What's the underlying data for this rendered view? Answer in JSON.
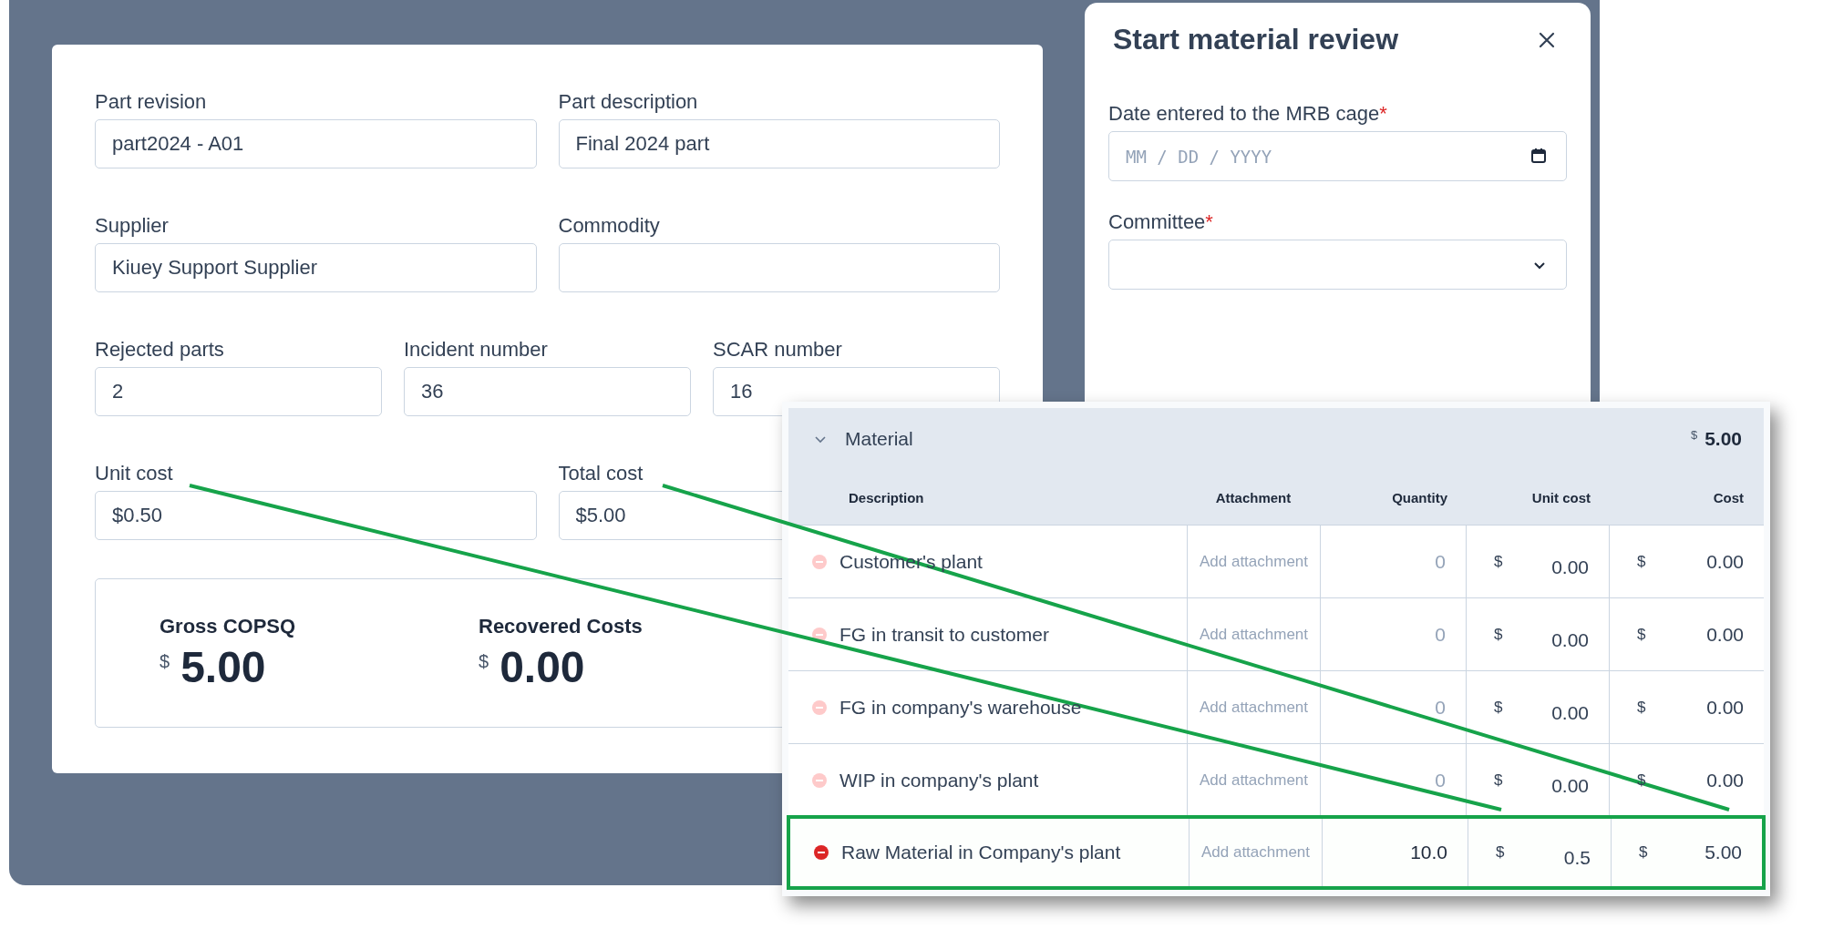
{
  "form": {
    "rows": [
      [
        {
          "label": "Part revision",
          "value": "part2024 - A01"
        },
        {
          "label": "Part description",
          "value": "Final 2024 part"
        }
      ],
      [
        {
          "label": "Supplier",
          "value": "Kiuey Support Supplier"
        },
        {
          "label": "Commodity"
        }
      ],
      [
        {
          "label": "Rejected parts",
          "value": "2"
        },
        {
          "label": "Incident number",
          "value": "36"
        },
        {
          "label": "SCAR number",
          "value": "16"
        }
      ],
      [
        {
          "label": "Unit cost",
          "value": "$0.50"
        },
        {
          "label": "Total cost",
          "value": "$5.00"
        }
      ]
    ],
    "summary": [
      {
        "label": "Gross COPSQ",
        "currency": "$",
        "amount": "5.00"
      },
      {
        "label": "Recovered Costs",
        "currency": "$",
        "amount": "0.00"
      }
    ]
  },
  "panel": {
    "title": "Start material review",
    "fields": [
      {
        "kind": "date",
        "label": "Date entered to the MRB cage",
        "required_mark": "*",
        "placeholder": "MM / DD / YYYY"
      },
      {
        "kind": "select",
        "label": "Committee",
        "required_mark": "*"
      }
    ]
  },
  "material": {
    "title": "Material",
    "expanded": true,
    "currency": "$",
    "total": "5.00",
    "columns": [
      "Description",
      "Attachment",
      "Quantity",
      "Unit cost",
      "Cost"
    ],
    "rows": [
      {
        "description": "Customer's plant",
        "attachment": "Add attachment",
        "quantity": "0",
        "unit_currency": "$",
        "unit_cost": "0.00",
        "cost_currency": "$",
        "cost": "0.00",
        "active": false,
        "highlighted": false
      },
      {
        "description": "FG in transit to customer",
        "attachment": "Add attachment",
        "quantity": "0",
        "unit_currency": "$",
        "unit_cost": "0.00",
        "cost_currency": "$",
        "cost": "0.00",
        "active": false,
        "highlighted": false
      },
      {
        "description": "FG in company's warehouse",
        "attachment": "Add attachment",
        "quantity": "0",
        "unit_currency": "$",
        "unit_cost": "0.00",
        "cost_currency": "$",
        "cost": "0.00",
        "active": false,
        "highlighted": false
      },
      {
        "description": "WIP in company's plant",
        "attachment": "Add attachment",
        "quantity": "0",
        "unit_currency": "$",
        "unit_cost": "0.00",
        "cost_currency": "$",
        "cost": "0.00",
        "active": false,
        "highlighted": false
      },
      {
        "description": "Raw Material in Company's plant",
        "attachment": "Add attachment",
        "quantity": "10.0",
        "unit_currency": "$",
        "unit_cost": "0.5",
        "cost_currency": "$",
        "cost": "5.00",
        "active": true,
        "highlighted": true
      }
    ]
  }
}
